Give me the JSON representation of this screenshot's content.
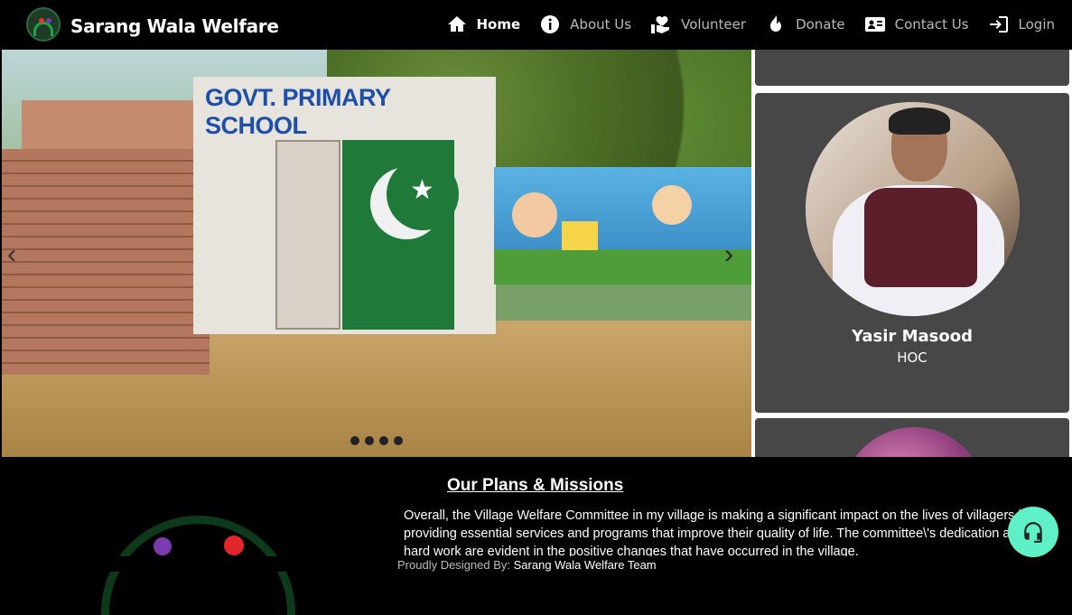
{
  "navbar": {
    "brand": "Sarang Wala Welfare",
    "items": [
      {
        "label": "Home",
        "icon": "home-icon",
        "active": true
      },
      {
        "label": "About Us",
        "icon": "info-icon",
        "active": false
      },
      {
        "label": "Volunteer",
        "icon": "volunteer-hand-heart-icon",
        "active": false
      },
      {
        "label": "Donate",
        "icon": "donate-icon",
        "active": false
      },
      {
        "label": "Contact Us",
        "icon": "contact-card-icon",
        "active": false
      },
      {
        "label": "Login",
        "icon": "login-icon",
        "active": false
      }
    ]
  },
  "carousel": {
    "slide_sign": "GOVT. PRIMARY SCHOOL",
    "indicator_count": 4,
    "active_indicator": 1
  },
  "members": [
    {
      "name": "Yasir Masood",
      "role": "HOC"
    }
  ],
  "plans": {
    "title": "Our Plans & Missions",
    "text_lines": [
      "Overall, the Village Welfare Committee in my village is making a significant impact on the lives of villagers by",
      "providing essential services and programs that improve their quality of life. The committee\\'s dedication and",
      "hard work are evident in the positive changes that have occurred in the village."
    ]
  },
  "footer": {
    "prefix": "Proudly Designed By:",
    "team": "Sarang Wala Welfare Team"
  },
  "colors": {
    "navbar_bg": "#000000",
    "card_bg": "#474747",
    "support_button": "#60f0c8"
  }
}
